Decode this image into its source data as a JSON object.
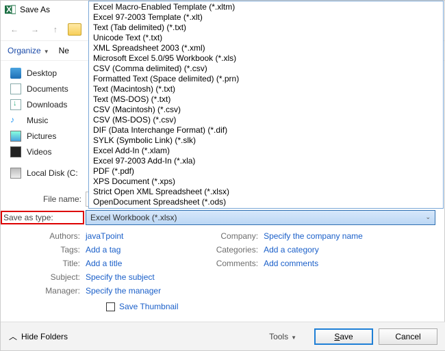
{
  "window": {
    "title": "Save As"
  },
  "toolbar": {
    "organize": "Organize",
    "newFragment": "Ne"
  },
  "sidebar": {
    "items": [
      {
        "label": "Desktop"
      },
      {
        "label": "Documents"
      },
      {
        "label": "Downloads"
      },
      {
        "label": "Music"
      },
      {
        "label": "Pictures"
      },
      {
        "label": "Videos"
      },
      {
        "label": "Local Disk (C:"
      }
    ]
  },
  "dropdown": {
    "options": [
      "Excel Macro-Enabled Template (*.xltm)",
      "Excel 97-2003 Template (*.xlt)",
      "Text (Tab delimited) (*.txt)",
      "Unicode Text (*.txt)",
      "XML Spreadsheet 2003 (*.xml)",
      "Microsoft Excel 5.0/95 Workbook (*.xls)",
      "CSV (Comma delimited) (*.csv)",
      "Formatted Text (Space delimited) (*.prn)",
      "Text (Macintosh) (*.txt)",
      "Text (MS-DOS) (*.txt)",
      "CSV (Macintosh) (*.csv)",
      "CSV (MS-DOS) (*.csv)",
      "DIF (Data Interchange Format) (*.dif)",
      "SYLK (Symbolic Link) (*.slk)",
      "Excel Add-In (*.xlam)",
      "Excel 97-2003 Add-In (*.xla)",
      "PDF (*.pdf)",
      "XPS Document (*.xps)",
      "Strict Open XML Spreadsheet (*.xlsx)",
      "OpenDocument Spreadsheet (*.ods)"
    ]
  },
  "fields": {
    "fileNameLabel": "File name:",
    "fileNameValue": "",
    "saveTypeLabel": "Save as type:",
    "saveTypeValue": "Excel Workbook (*.xlsx)"
  },
  "meta": {
    "authorsLabel": "Authors:",
    "authorsValue": "javaTpoint",
    "tagsLabel": "Tags:",
    "tagsValue": "Add a tag",
    "titleLabel": "Title:",
    "titleValue": "Add a title",
    "subjectLabel": "Subject:",
    "subjectValue": "Specify the subject",
    "managerLabel": "Manager:",
    "managerValue": "Specify the manager",
    "companyLabel": "Company:",
    "companyValue": "Specify the company name",
    "categoriesLabel": "Categories:",
    "categoriesValue": "Add a category",
    "commentsLabel": "Comments:",
    "commentsValue": "Add comments"
  },
  "thumb": {
    "label": "Save Thumbnail"
  },
  "footer": {
    "hideFolders": "Hide Folders",
    "tools": "Tools",
    "save": "Save",
    "cancel": "Cancel"
  }
}
